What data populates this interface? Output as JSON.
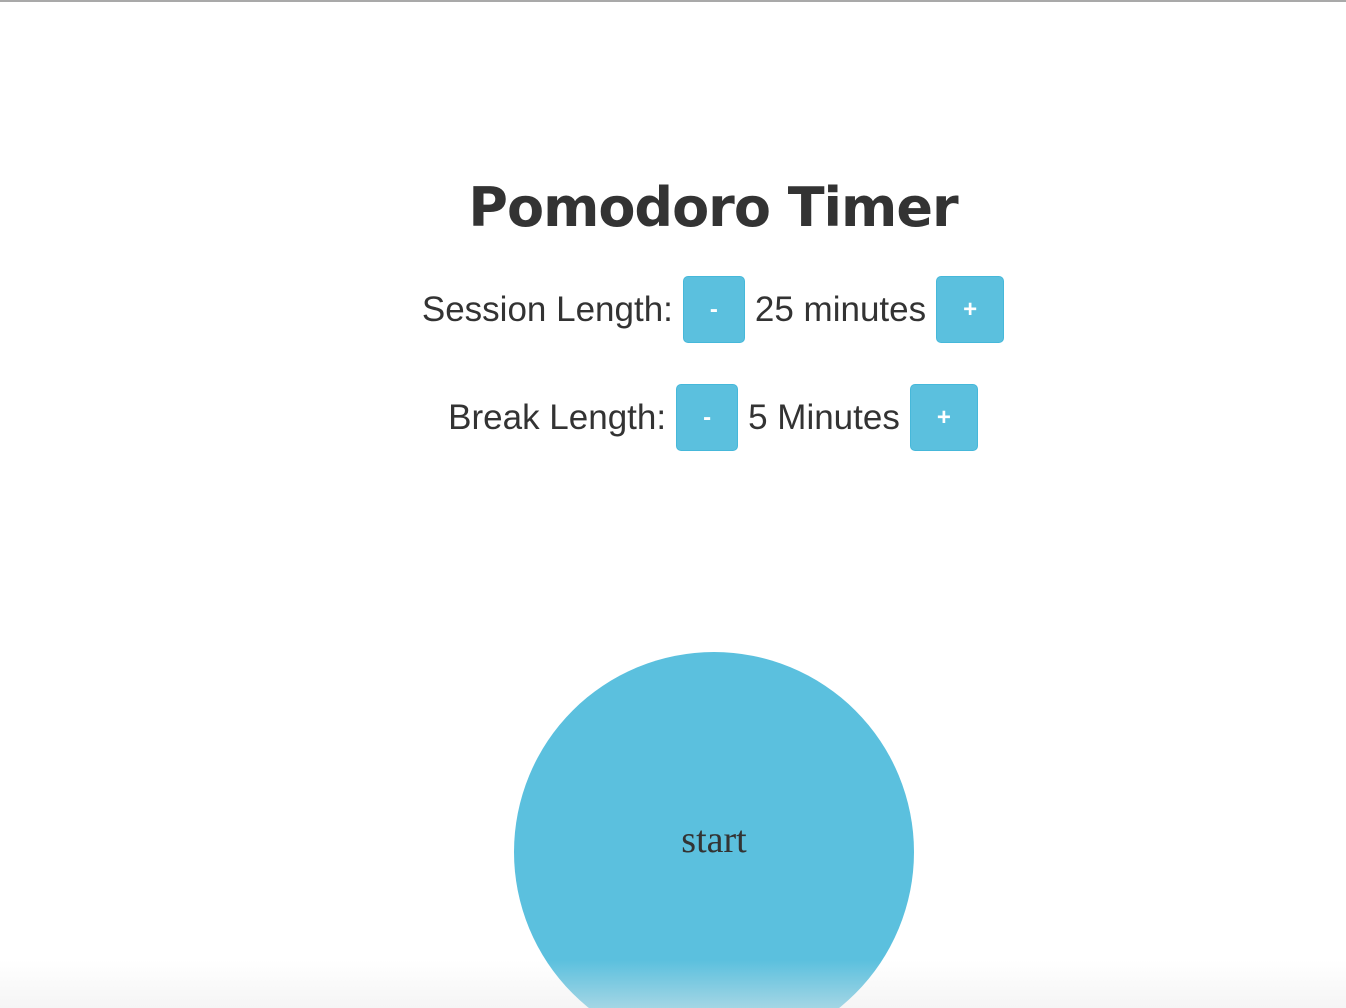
{
  "app": {
    "title": "Pomodoro Timer"
  },
  "session": {
    "label": "Session Length:",
    "decrement_label": "-",
    "value": "25 minutes",
    "increment_label": "+"
  },
  "break": {
    "label": "Break Length:",
    "decrement_label": "-",
    "value": "5 Minutes",
    "increment_label": "+"
  },
  "timer": {
    "start_label": "start"
  },
  "colors": {
    "accent": "#5bc0de",
    "text": "#333333",
    "button_text": "#ffffff"
  }
}
